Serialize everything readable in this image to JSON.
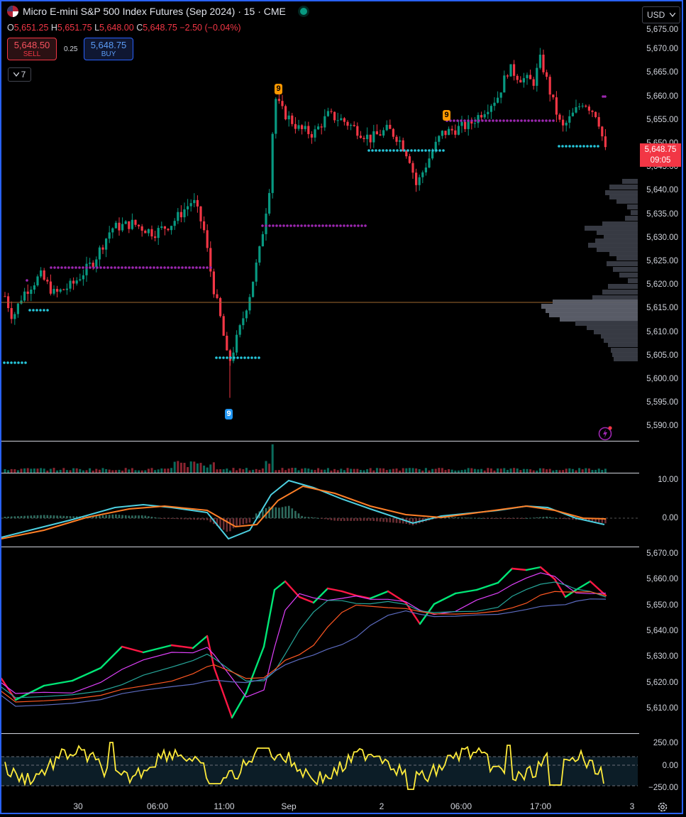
{
  "header": {
    "symbol_title": "Micro E-mini S&P 500 Index Futures (Sep 2024) · 15 · CME"
  },
  "ohlc": {
    "o_label": "O",
    "o": "5,651.25",
    "h_label": "H",
    "h": "5,651.75",
    "l_label": "L",
    "l": "5,648.00",
    "c_label": "C",
    "c": "5,648.75",
    "change": "−2.50 (−0.04%)"
  },
  "trade": {
    "sell_price": "5,648.50",
    "sell_label": "SELL",
    "spread": "0.25",
    "buy_price": "5,648.75",
    "buy_label": "BUY"
  },
  "indicators_count": "7",
  "currency": "USD",
  "price_tag": {
    "price": "5,648.75",
    "countdown": "09:05"
  },
  "signals": {
    "label": "9"
  },
  "main_axis": [
    "5,675.00",
    "5,670.00",
    "5,665.00",
    "5,660.00",
    "5,655.00",
    "5,650.00",
    "5,645.00",
    "5,640.00",
    "5,635.00",
    "5,630.00",
    "5,625.00",
    "5,620.00",
    "5,615.00",
    "5,610.00",
    "5,605.00",
    "5,600.00",
    "5,595.00",
    "5,590.00"
  ],
  "macd_axis": [
    "10.00",
    "0.00"
  ],
  "ma_axis": [
    "5,670.00",
    "5,660.00",
    "5,650.00",
    "5,640.00",
    "5,630.00",
    "5,620.00",
    "5,610.00"
  ],
  "osc_axis": [
    "250.00",
    "0.00",
    "−250.00"
  ],
  "time_axis": [
    "30",
    "06:00",
    "11:00",
    "Sep",
    "2",
    "06:00",
    "17:00",
    "3"
  ],
  "colors": {
    "up": "#089981",
    "down": "#f23645",
    "accent": "#2962ff",
    "purple": "#9c27b0",
    "cyan": "#26c6da",
    "yellow": "#ffeb3b"
  },
  "icons": {
    "settings": "gear-icon",
    "alert": "lightning-icon"
  }
}
